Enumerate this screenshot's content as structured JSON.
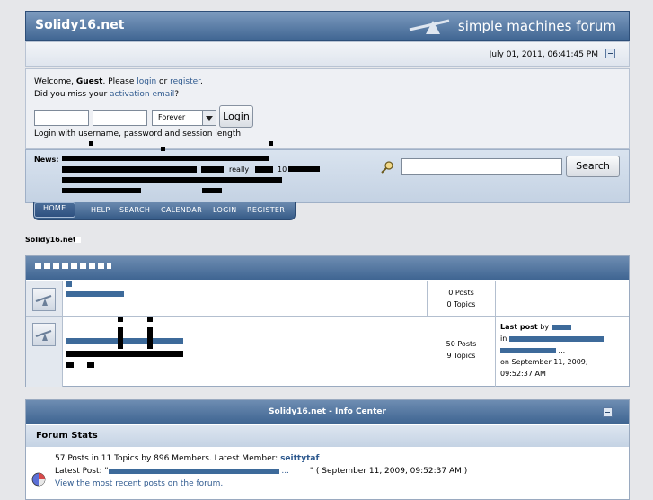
{
  "header": {
    "site_title": "Solidy16.net",
    "logo_text": "simple machines forum"
  },
  "datebar": {
    "date": "July 01, 2011, 06:41:45 PM"
  },
  "user": {
    "welcome_prefix": "Welcome, ",
    "guest": "Guest",
    "please": ". Please ",
    "login_link": "login",
    "or": " or ",
    "register_link": "register",
    "end": ".",
    "activation_prefix": "Did you miss your ",
    "activation_link": "activation email",
    "activation_suffix": "?",
    "duration_selected": "Forever",
    "login_button": "Login",
    "login_hint": "Login with username, password and session length"
  },
  "news": {
    "label": "News:",
    "visible_fragment_1": "really",
    "visible_fragment_2": "10"
  },
  "search": {
    "button": "Search"
  },
  "menu": {
    "items": [
      "HOME",
      "HELP",
      "SEARCH",
      "CALENDAR",
      "LOGIN",
      "REGISTER"
    ]
  },
  "breadcrumb": "Solidy16.net",
  "boards": [
    {
      "posts": "0 Posts",
      "topics": "0 Topics"
    },
    {
      "posts": "50 Posts",
      "topics": "9 Topics",
      "last_post_label": "Last post",
      "by": "by",
      "in": "in",
      "ellipsis": "...",
      "on": "on September 11, 2009,",
      "time": "09:52:37 AM"
    }
  ],
  "info_center": {
    "title": "Solidy16.net - Info Center",
    "stats_header": "Forum Stats",
    "line1_prefix": "57 Posts in 11 Topics by 896 Members. Latest Member: ",
    "latest_member": "seittytaf",
    "line2_prefix": "Latest Post: \"",
    "line2_ellipsis": "...",
    "line2_suffix": "\" ( September 11, 2009, 09:52:37 AM )",
    "recent_link": "View the most recent posts on the forum."
  },
  "colors": {
    "header_blue": "#3f6592",
    "link_blue": "#2f5a8f"
  },
  "icons": [
    "scale-logo-icon",
    "collapse-icon",
    "magnifier-icon",
    "board-icon",
    "stats-pie-icon"
  ]
}
